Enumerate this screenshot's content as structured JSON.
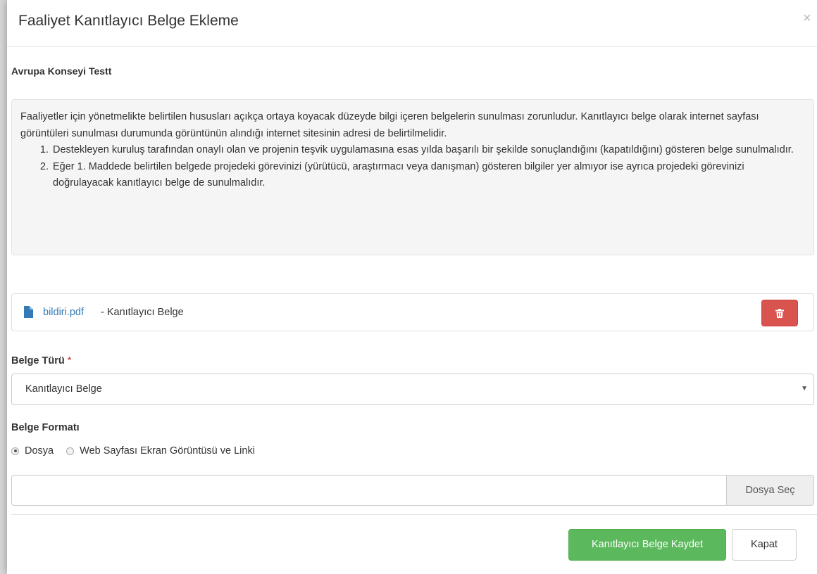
{
  "modal": {
    "title": "Faaliyet Kanıtlayıcı Belge Ekleme",
    "close_symbol": "×",
    "activity_name": "Avrupa Konseyi Testt"
  },
  "info": {
    "intro": "Faaliyetler için yönetmelikte belirtilen hususları açıkça ortaya koyacak düzeyde bilgi içeren belgelerin sunulması zorunludur. Kanıtlayıcı belge olarak internet sayfası görüntüleri sunulması durumunda görüntünün alındığı internet sitesinin adresi de belirtilmelidir.",
    "items": [
      "Destekleyen kuruluş tarafından onaylı olan ve projenin teşvik uygulamasına esas yılda başarılı bir şekilde sonuçlandığını (kapatıldığını) gösteren belge sunulmalıdır.",
      "Eğer 1. Maddede belirtilen belgede projedeki görevinizi (yürütücü, araştırmacı veya danışman) gösteren bilgiler yer almıyor ise ayrıca projedeki görevinizi doğrulayacak kanıtlayıcı belge de sunulmalıdır."
    ]
  },
  "attachment": {
    "file_name": "bildiri.pdf",
    "description": " - Kanıtlayıcı Belge",
    "icon": "file-icon",
    "delete_icon": "trash-icon"
  },
  "form": {
    "type_label": "Belge Türü",
    "required_mark": "*",
    "type_selected": "Kanıtlayıcı Belge",
    "format_label": "Belge Formatı",
    "format_options": [
      {
        "label": "Dosya",
        "checked": true
      },
      {
        "label": "Web Sayfası Ekran Görüntüsü ve Linki",
        "checked": false
      }
    ],
    "file_value": "",
    "file_button": "Dosya Seç"
  },
  "footer": {
    "save_label": "Kanıtlayıcı Belge Kaydet",
    "close_label": "Kapat"
  },
  "colors": {
    "link": "#337ab7",
    "danger": "#d9534f",
    "success": "#5cb85c",
    "info_bg": "#f5f5f5"
  }
}
